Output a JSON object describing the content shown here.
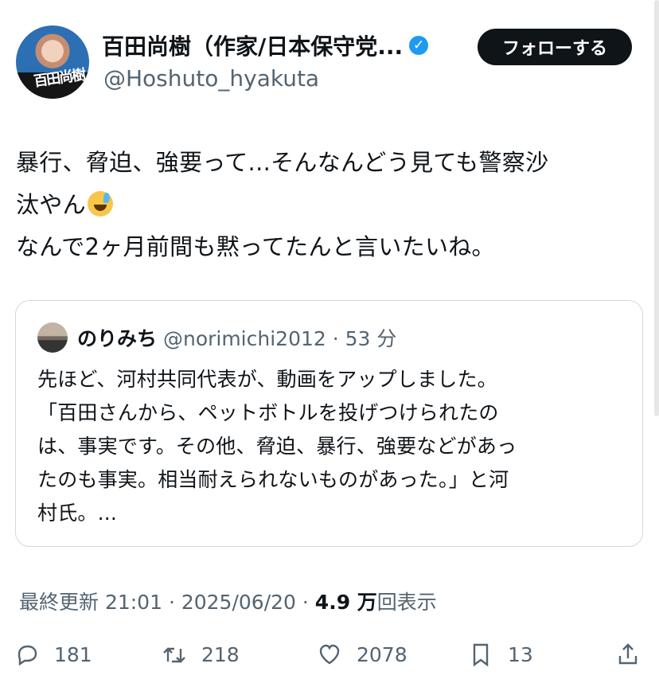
{
  "author": {
    "avatar_text": "百田尚樹",
    "display_name": "百田尚樹（作家/日本保守党...",
    "verified_icon": "verified-badge-icon",
    "handle": "@Hoshuto_hyakuta",
    "follow_label": "フォローする"
  },
  "post": {
    "line1": "暴行、脅迫、強要って...そんなんどう見ても警察沙",
    "line2": "汰やん",
    "line3": "なんで2ヶ月前間も黙ってたんと言いたいね。",
    "emoji": "grinning-face-with-sweat"
  },
  "quote": {
    "name": "のりみち",
    "handle": "@norimichi2012",
    "time": "53 分",
    "lines": [
      "先ほど、河村共同代表が、動画をアップしました。",
      "「百田さんから、ペットボトルを投げつけられたの",
      "は、事実です。その他、脅迫、暴行、強要などがあっ",
      "たのも事実。相当耐えられないものがあった。」と河",
      "村氏。..."
    ]
  },
  "meta": {
    "updated": "最終更新 21:01 · 2025/06/20",
    "dot": "·",
    "views_count": "4.9 万",
    "views_label": "回表示"
  },
  "actions": {
    "replies": "181",
    "reposts": "218",
    "likes": "2078",
    "bookmarks": "13"
  }
}
